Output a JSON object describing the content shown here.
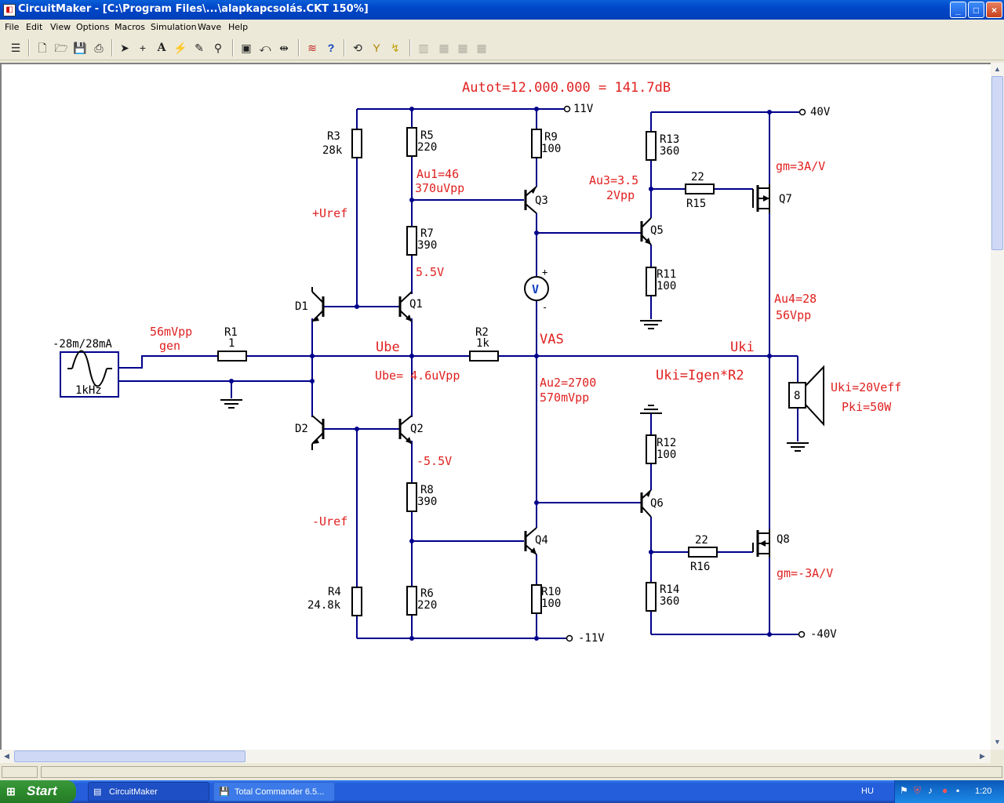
{
  "window": {
    "title": "CircuitMaker - [C:\\Program Files\\...\\alapkapcsolás.CKT 150%]",
    "minimize": "_",
    "maximize": "□",
    "close": "×"
  },
  "menu": [
    "File",
    "Edit",
    "View",
    "Options",
    "Macros",
    "Simulation",
    "Wave",
    "Help"
  ],
  "toolbar": {
    "icons": [
      "parts-icon",
      "new-icon",
      "open-icon",
      "save-icon",
      "print-icon",
      "arrow-tool-icon",
      "wire-tool-icon",
      "text-tool-icon",
      "probe-tool-icon",
      "paint-tool-icon",
      "zoom-tool-icon",
      "zoom-fit-icon",
      "rotate-icon",
      "mirror-icon",
      "digital-analog-icon",
      "help-icon",
      "undo-icon",
      "trace-icon",
      "run-icon",
      "group1-icon",
      "group2-icon",
      "group3-icon",
      "group4-icon"
    ]
  },
  "schematic": {
    "title": "Autot=12.000.000 = 141.7dB",
    "rails": {
      "pos_small": "11V",
      "neg_small": "-11V",
      "pos_big": "40V",
      "neg_big": "-40V"
    },
    "source": {
      "current": "-28m/28mA",
      "freq": "1kHz",
      "amplitude": "56mVpp",
      "name": "gen"
    },
    "resistors": {
      "R1": [
        "R1",
        "1"
      ],
      "R2": [
        "R2",
        "1k"
      ],
      "R3": [
        "R3",
        "28k"
      ],
      "R4": [
        "R4",
        "24.8k"
      ],
      "R5": [
        "R5",
        "220"
      ],
      "R6": [
        "R6",
        "220"
      ],
      "R7": [
        "R7",
        "390"
      ],
      "R8": [
        "R8",
        "390"
      ],
      "R9": [
        "R9",
        "100"
      ],
      "R10": [
        "R10",
        "100"
      ],
      "R11": [
        "R11",
        "100"
      ],
      "R12": [
        "R12",
        "100"
      ],
      "R13": [
        "R13",
        "360"
      ],
      "R14": [
        "R14",
        "360"
      ],
      "R15": [
        "R15",
        "22"
      ],
      "R16": [
        "R16",
        "22"
      ]
    },
    "transistors": {
      "D1": "D1",
      "D2": "D2",
      "Q1": "Q1",
      "Q2": "Q2",
      "Q3": "Q3",
      "Q4": "Q4",
      "Q5": "Q5",
      "Q6": "Q6",
      "Q7": "Q7",
      "Q8": "Q8"
    },
    "annotations": {
      "uref_pos": "+Uref",
      "uref_neg": "-Uref",
      "v55": "5.5V",
      "vm55": "-5.5V",
      "ube": "Ube",
      "ube_val": "Ube= 4.6uVpp",
      "au1": "Au1=46",
      "au1b": "370uVpp",
      "au2": "Au2=2700",
      "au2b": "570mVpp",
      "vas": "VAS",
      "au3": "Au3=3.5",
      "au3b": "2Vpp",
      "au4": "Au4=28",
      "au4b": "56Vpp",
      "uki": "Uki",
      "uki_eq": "Uki=Igen*R2",
      "uki_eff": "Uki=20Veff",
      "pki": "Pki=50W",
      "gm7": "gm=3A/V",
      "gm8": "gm=-3A/V",
      "speaker": "8",
      "voltmeter": "V",
      "vplus": "+",
      "vminus": "-"
    }
  },
  "colors": {
    "wire": "#00008b",
    "red": "#e02020",
    "part": "#000000"
  },
  "taskbar": {
    "start": "Start",
    "tasks": [
      "CircuitMaker",
      "Total Commander 6.5..."
    ],
    "lang": "HU",
    "clock": "1:20"
  }
}
